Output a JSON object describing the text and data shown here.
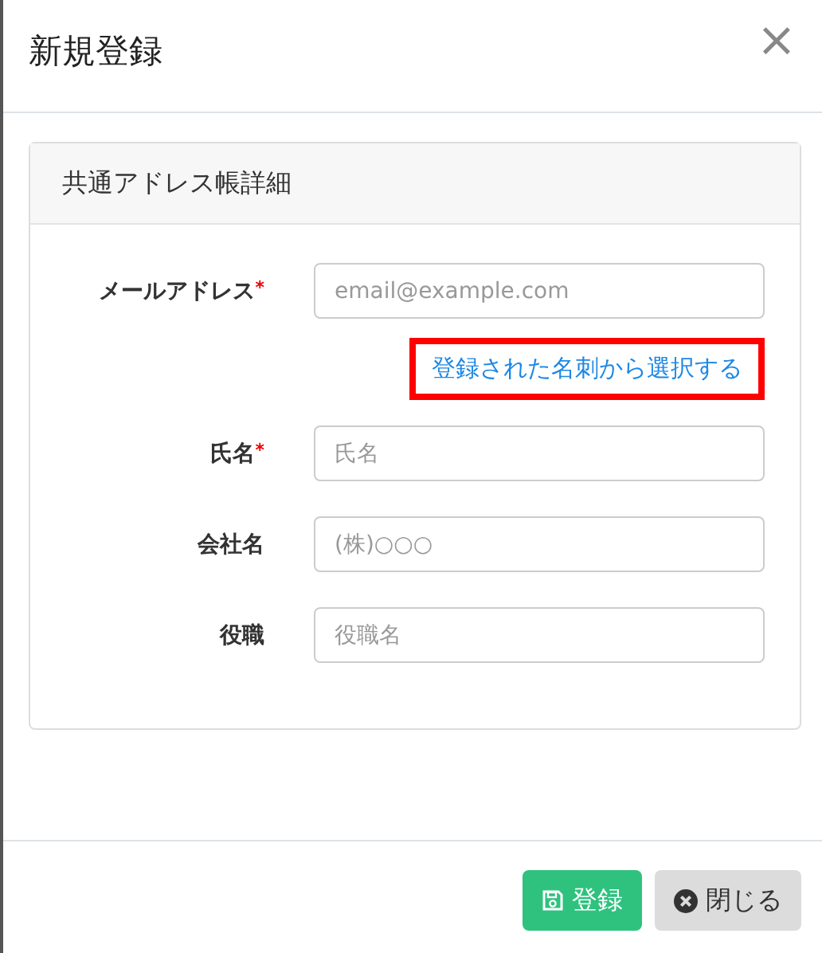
{
  "dialog": {
    "title": "新規登録",
    "close": "×"
  },
  "panel": {
    "title": "共通アドレス帳詳細",
    "fields": [
      {
        "label": "メールアドレス",
        "required_mark": "*",
        "placeholder": "email@example.com",
        "link": {
          "text": "登録された名刺から選択する",
          "highlighted": true
        }
      },
      {
        "label": "氏名",
        "required_mark": "*",
        "placeholder": "氏名"
      },
      {
        "label": "会社名",
        "placeholder": "(株)○○○"
      },
      {
        "label": "役職",
        "placeholder": "役職名"
      }
    ]
  },
  "buttons": [
    {
      "kind": "primary",
      "label": "登録"
    },
    {
      "kind": "secondary",
      "label": "閉じる"
    }
  ]
}
